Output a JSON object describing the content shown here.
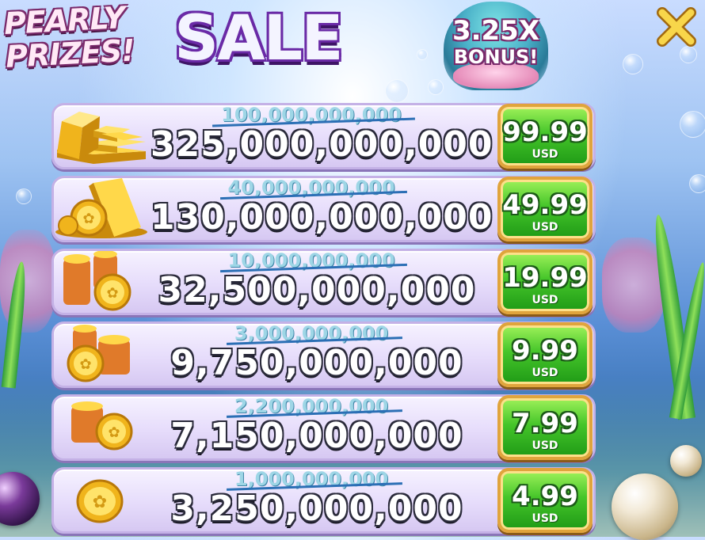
{
  "header": {
    "logo_line1": "PEARLY",
    "logo_line2": "PRIZES!",
    "sale_label": "SALE",
    "bonus_multiplier": "3.25X",
    "bonus_label": "BONUS!"
  },
  "colors": {
    "row_bg": "#e6dcfb",
    "buy_green": "#45c52a",
    "buy_border": "#e0a43c",
    "old_amount": "#9ed6e6",
    "strike_line": "#2b6fb5",
    "close_icon": "#f5d24a"
  },
  "offers": [
    {
      "icon": "gold-bars-icon",
      "old_amount": "100,000,000,000",
      "amount": "325,000,000,000",
      "price": "99.99",
      "currency": "USD"
    },
    {
      "icon": "gold-bar-coins-icon",
      "old_amount": "40,000,000,000",
      "amount": "130,000,000,000",
      "price": "49.99",
      "currency": "USD"
    },
    {
      "icon": "coin-stacks-large-icon",
      "old_amount": "10,000,000,000",
      "amount": "32,500,000,000",
      "price": "19.99",
      "currency": "USD"
    },
    {
      "icon": "coin-stacks-medium-icon",
      "old_amount": "3,000,000,000",
      "amount": "9,750,000,000",
      "price": "9.99",
      "currency": "USD"
    },
    {
      "icon": "coin-stack-small-icon",
      "old_amount": "2,200,000,000",
      "amount": "7,150,000,000",
      "price": "7.99",
      "currency": "USD"
    },
    {
      "icon": "single-coin-icon",
      "old_amount": "1,000,000,000",
      "amount": "3,250,000,000",
      "price": "4.99",
      "currency": "USD"
    }
  ]
}
